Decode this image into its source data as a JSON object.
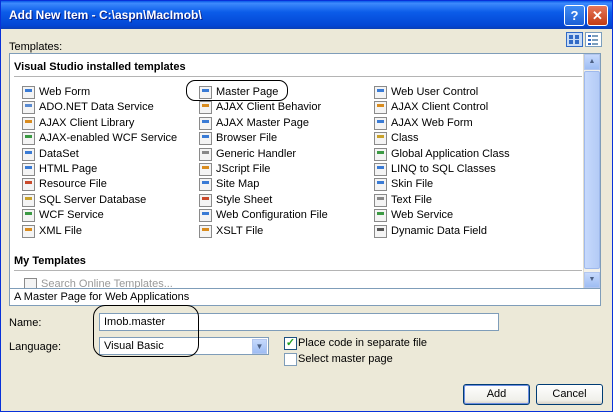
{
  "window": {
    "title": "Add New Item - C:\\aspn\\MacImob\\",
    "help_glyph": "?",
    "close_glyph": "✕"
  },
  "templates_label": "Templates:",
  "groups": {
    "installed": "Visual Studio installed templates",
    "my": "My Templates",
    "search": "Search Online Templates..."
  },
  "columns": [
    [
      {
        "label": "Web Form",
        "icon": "web-form-icon",
        "color": "#3a7bd5"
      },
      {
        "label": "ADO.NET Data Service",
        "icon": "data-service-icon",
        "color": "#5b8bd0"
      },
      {
        "label": "AJAX Client Library",
        "icon": "ajax-library-icon",
        "color": "#d98c1f"
      },
      {
        "label": "AJAX-enabled WCF Service",
        "icon": "wcf-service-icon",
        "color": "#3c9a44"
      },
      {
        "label": "DataSet",
        "icon": "dataset-icon",
        "color": "#3a7bd5"
      },
      {
        "label": "HTML Page",
        "icon": "html-page-icon",
        "color": "#3a7bd5"
      },
      {
        "label": "Resource File",
        "icon": "resource-file-icon",
        "color": "#c94a2c"
      },
      {
        "label": "SQL Server Database",
        "icon": "database-icon",
        "color": "#c9a22c"
      },
      {
        "label": "WCF Service",
        "icon": "wcf-icon",
        "color": "#3c9a44"
      },
      {
        "label": "XML File",
        "icon": "xml-file-icon",
        "color": "#d98c1f"
      }
    ],
    [
      {
        "label": "Master Page",
        "icon": "master-page-icon",
        "color": "#3a7bd5"
      },
      {
        "label": "AJAX Client Behavior",
        "icon": "ajax-behavior-icon",
        "color": "#d98c1f"
      },
      {
        "label": "AJAX Master Page",
        "icon": "ajax-master-page-icon",
        "color": "#3a7bd5"
      },
      {
        "label": "Browser File",
        "icon": "browser-file-icon",
        "color": "#3a7bd5"
      },
      {
        "label": "Generic Handler",
        "icon": "generic-handler-icon",
        "color": "#888888"
      },
      {
        "label": "JScript File",
        "icon": "jscript-file-icon",
        "color": "#d98c1f"
      },
      {
        "label": "Site Map",
        "icon": "site-map-icon",
        "color": "#3a7bd5"
      },
      {
        "label": "Style Sheet",
        "icon": "style-sheet-icon",
        "color": "#c94a2c"
      },
      {
        "label": "Web Configuration File",
        "icon": "web-config-icon",
        "color": "#3a7bd5"
      },
      {
        "label": "XSLT File",
        "icon": "xslt-file-icon",
        "color": "#d98c1f"
      }
    ],
    [
      {
        "label": "Web User Control",
        "icon": "web-user-control-icon",
        "color": "#3a7bd5"
      },
      {
        "label": "AJAX Client Control",
        "icon": "ajax-control-icon",
        "color": "#d98c1f"
      },
      {
        "label": "AJAX Web Form",
        "icon": "ajax-web-form-icon",
        "color": "#3a7bd5"
      },
      {
        "label": "Class",
        "icon": "class-icon",
        "color": "#c9a22c"
      },
      {
        "label": "Global Application Class",
        "icon": "global-app-icon",
        "color": "#3c9a44"
      },
      {
        "label": "LINQ to SQL Classes",
        "icon": "linq-icon",
        "color": "#3a7bd5"
      },
      {
        "label": "Skin File",
        "icon": "skin-file-icon",
        "color": "#3a7bd5"
      },
      {
        "label": "Text File",
        "icon": "text-file-icon",
        "color": "#888888"
      },
      {
        "label": "Web Service",
        "icon": "web-service-icon",
        "color": "#3c9a44"
      },
      {
        "label": "Dynamic Data Field",
        "icon": "dynamic-data-icon",
        "color": "#555555"
      }
    ]
  ],
  "description": "A Master Page for Web Applications",
  "name": {
    "label": "Name:",
    "value": "Imob.master"
  },
  "language": {
    "label": "Language:",
    "value": "Visual Basic"
  },
  "options": {
    "separate_file": "Place code in separate file",
    "separate_file_checked": true,
    "master_page": "Select master page",
    "master_page_checked": false
  },
  "buttons": {
    "add": "Add",
    "cancel": "Cancel"
  },
  "colors": {
    "title_bar": "#0054e3",
    "dialog_bg": "#ece9d8",
    "selection_border": "#000000"
  }
}
